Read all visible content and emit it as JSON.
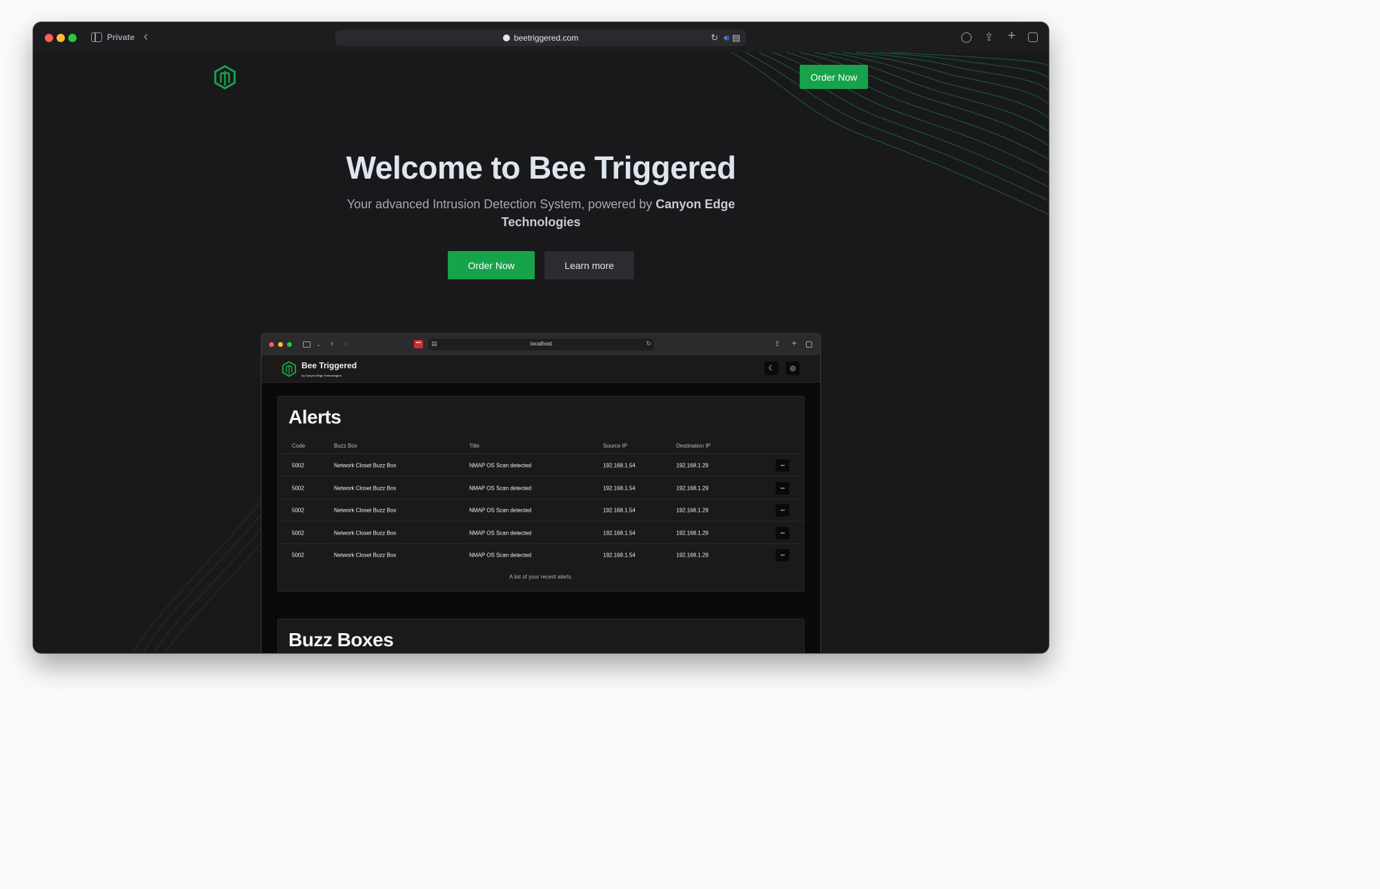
{
  "browser": {
    "private_label": "Private",
    "url": "beetriggered.com"
  },
  "nav": {
    "order_label": "Order Now"
  },
  "hero": {
    "title": "Welcome to Bee Triggered",
    "subtitle_prefix": "Your advanced Intrusion Detection System, powered by ",
    "subtitle_brand": "Canyon Edge Technologies",
    "primary_button": "Order Now",
    "secondary_button": "Learn more"
  },
  "preview": {
    "url": "localhost",
    "app_title": "Bee Triggered",
    "app_subtitle": "by Canyon Edge Technologies",
    "alerts": {
      "title": "Alerts",
      "columns": [
        "Code",
        "Buzz Box",
        "Title",
        "Source IP",
        "Destination IP"
      ],
      "rows": [
        {
          "code": "5002",
          "box": "Network Closet Buzz Box",
          "title": "NMAP OS Scan detected",
          "src": "192.168.1.54",
          "dst": "192.168.1.29"
        },
        {
          "code": "5002",
          "box": "Network Closet Buzz Box",
          "title": "NMAP OS Scan detected",
          "src": "192.168.1.54",
          "dst": "192.168.1.29"
        },
        {
          "code": "5002",
          "box": "Network Closet Buzz Box",
          "title": "NMAP OS Scan detected",
          "src": "192.168.1.54",
          "dst": "192.168.1.29"
        },
        {
          "code": "5002",
          "box": "Network Closet Buzz Box",
          "title": "NMAP OS Scan detected",
          "src": "192.168.1.54",
          "dst": "192.168.1.29"
        },
        {
          "code": "5002",
          "box": "Network Closet Buzz Box",
          "title": "NMAP OS Scan detected",
          "src": "192.168.1.54",
          "dst": "192.168.1.29"
        }
      ],
      "caption": "A list of your recent alerts."
    },
    "buzz_boxes": {
      "title": "Buzz Boxes"
    }
  },
  "colors": {
    "accent": "#16a34a",
    "background": "#19191b",
    "preview_background": "#0b0a0a",
    "card": "#1c1a19"
  },
  "icons": [
    "sidebar-toggle-icon",
    "back-arrow-icon",
    "reload-icon",
    "speaker-icon",
    "reader-icon",
    "download-icon",
    "share-icon",
    "new-tab-icon",
    "tab-overview-icon",
    "moon-icon",
    "user-icon",
    "more-icon"
  ]
}
